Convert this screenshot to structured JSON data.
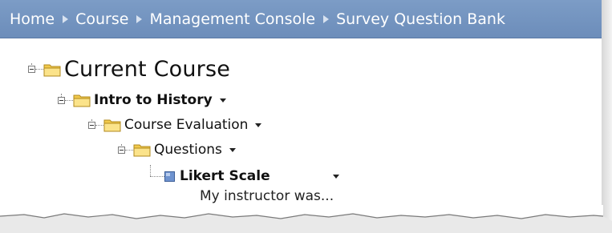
{
  "breadcrumb": [
    "Home",
    "Course",
    "Management Console",
    "Survey Question Bank"
  ],
  "tree": {
    "root": "Current Course",
    "level1": "Intro to History",
    "level2": "Course Evaluation",
    "level3": "Questions",
    "item": {
      "label": "Likert Scale",
      "description": "My instructor was..."
    }
  },
  "icons": {
    "folder": "folder-icon",
    "question": "question-item-icon",
    "expander": "collapse-icon",
    "menu": "dropdown-caret-icon"
  },
  "colors": {
    "bar": "#7396c4",
    "folder_fill": "#f5d36a",
    "item_icon": "#5f86c7"
  }
}
